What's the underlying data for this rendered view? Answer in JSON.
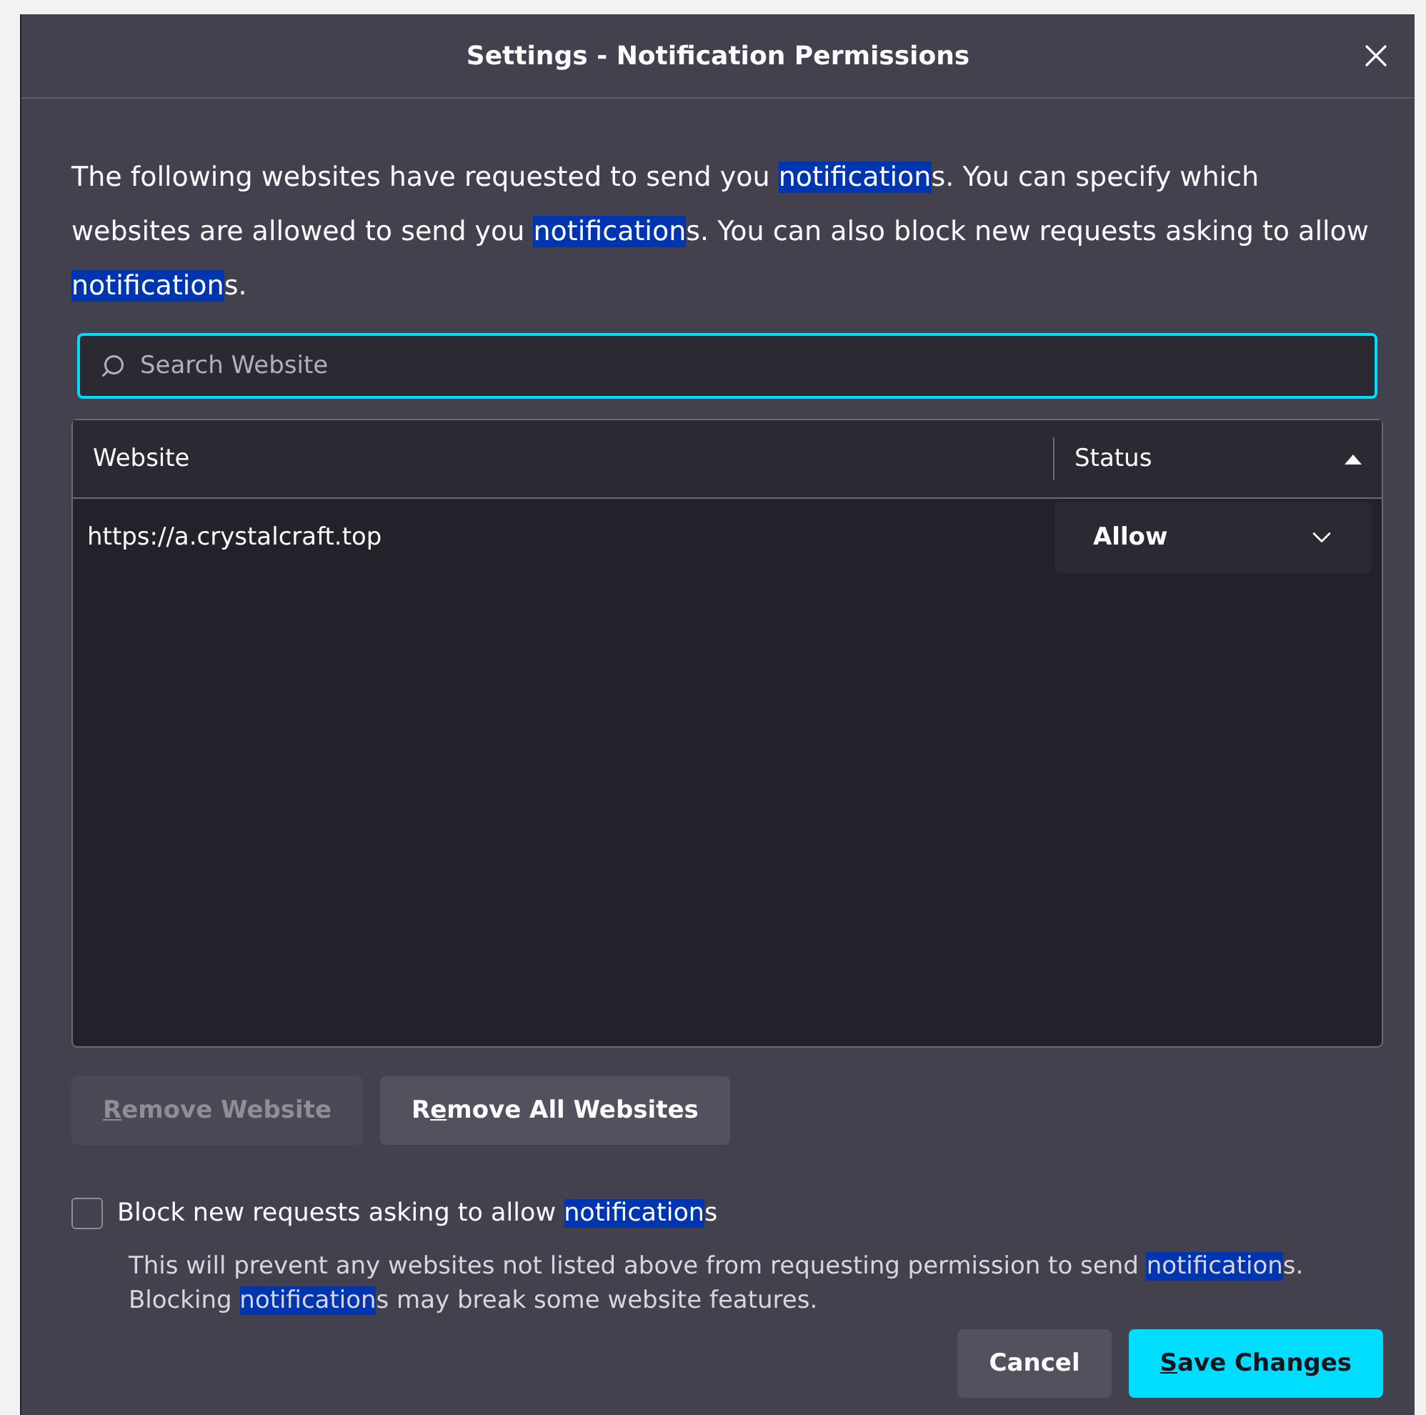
{
  "window": {
    "title": "Settings - Notification Permissions"
  },
  "intro": [
    {
      "text": "The following websites have requested to send you ",
      "highlighted": false
    },
    {
      "text": "notification",
      "highlighted": true
    },
    {
      "text": "s. You can specify which websites are allowed to send you ",
      "highlighted": false
    },
    {
      "text": "notification",
      "highlighted": true
    },
    {
      "text": "s. You can also block new requests asking to allow ",
      "highlighted": false
    },
    {
      "text": "notification",
      "highlighted": true
    },
    {
      "text": "s.",
      "highlighted": false
    }
  ],
  "search": {
    "placeholder": "Search Website"
  },
  "table": {
    "columns": [
      {
        "label": "Website"
      },
      {
        "label": "Status",
        "sorted": true
      }
    ],
    "rows": [
      {
        "website": "https://a.crystalcraft.top",
        "status": "Allow"
      }
    ]
  },
  "buttons": [
    {
      "label": [
        {
          "text": "R",
          "underlined": true
        },
        {
          "text": "emove Website",
          "underlined": false
        }
      ],
      "disabled": true
    },
    {
      "label": [
        {
          "text": "R",
          "underlined": false
        },
        {
          "text": "e",
          "underlined": true
        },
        {
          "text": "move All Websites",
          "underlined": false
        }
      ],
      "disabled": false
    }
  ],
  "block": {
    "checked": false,
    "label": [
      {
        "text": "Block new requests asking to allow ",
        "highlighted": false
      },
      {
        "text": "notification",
        "highlighted": true
      },
      {
        "text": "s",
        "highlighted": false
      }
    ],
    "note": [
      {
        "text": "This will prevent any websites not listed above from requesting permission to send ",
        "highlighted": false
      },
      {
        "text": "notification",
        "highlighted": true
      },
      {
        "text": "s. Blocking ",
        "highlighted": false
      },
      {
        "text": "notification",
        "highlighted": true
      },
      {
        "text": "s may break some website features.",
        "highlighted": false
      }
    ]
  },
  "footer": [
    {
      "kind": "secondary",
      "label": [
        {
          "text": "Cancel",
          "underlined": false
        }
      ]
    },
    {
      "kind": "primary",
      "label": [
        {
          "text": "S",
          "underlined": true
        },
        {
          "text": "ave Changes",
          "underlined": false
        }
      ]
    }
  ]
}
